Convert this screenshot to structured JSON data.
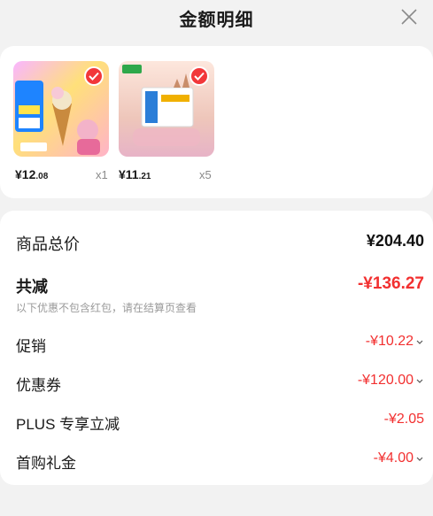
{
  "header": {
    "title": "金额明细"
  },
  "products": [
    {
      "price_main": "¥12",
      "price_decimal": ".08",
      "qty": "x1"
    },
    {
      "price_main": "¥11",
      "price_decimal": ".21",
      "qty": "x5"
    }
  ],
  "summary": {
    "total_label": "商品总价",
    "total_value": "¥204.40",
    "reduce_label": "共减",
    "reduce_value": "-¥136.27",
    "note": "以下优惠不包含红包，请在结算页查看"
  },
  "discounts": [
    {
      "label": "促销",
      "value": "-¥10.22"
    },
    {
      "label": "优惠券",
      "value": "-¥120.00"
    },
    {
      "label": "PLUS 专享立减",
      "value": "-¥2.05"
    },
    {
      "label": "首购礼金",
      "value": "-¥4.00"
    }
  ],
  "colors": {
    "accent": "#f23030",
    "check_badge": "#f2373a",
    "background": "#f2f2f2"
  }
}
